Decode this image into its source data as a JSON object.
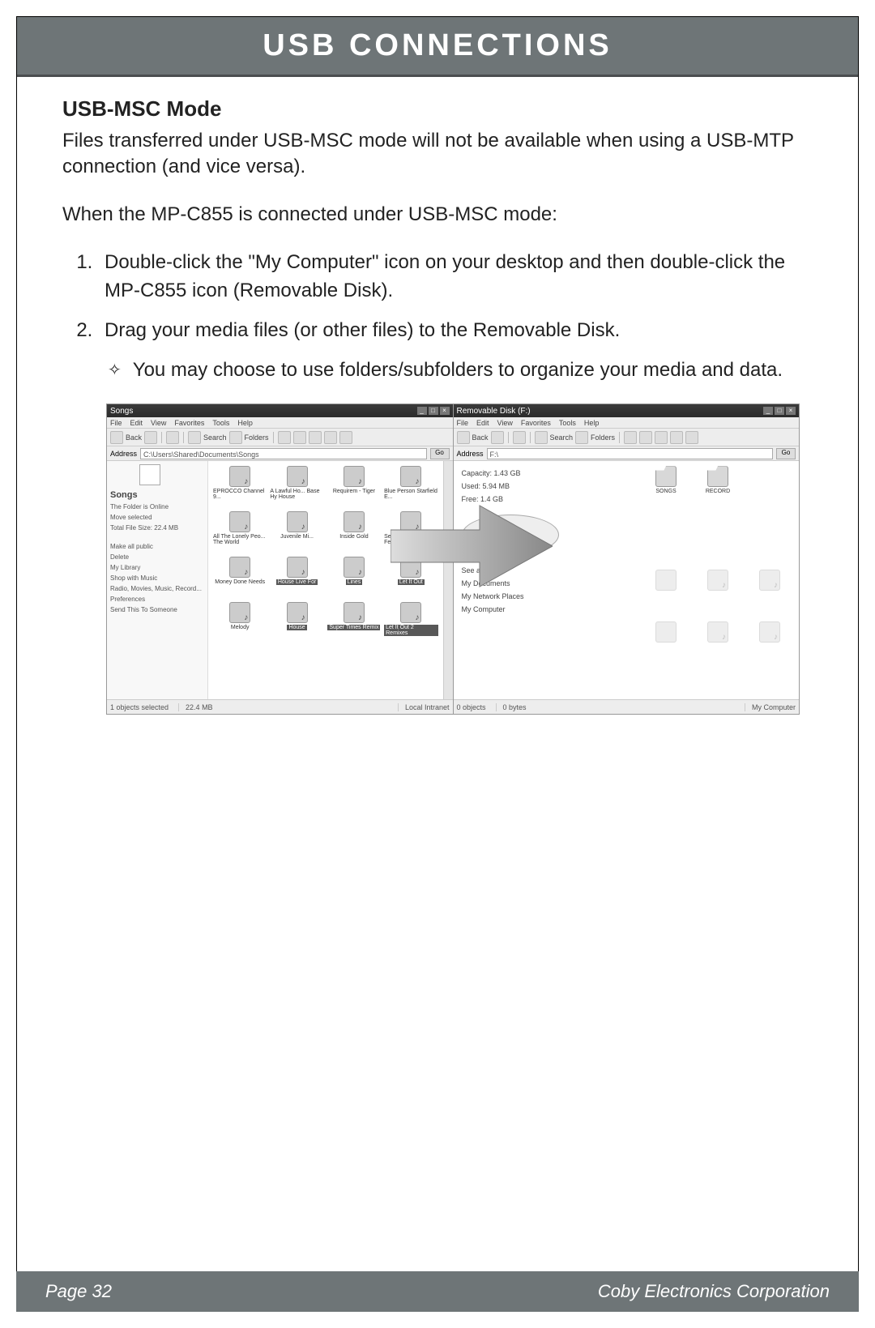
{
  "header": {
    "title": "USB CONNECTIONS"
  },
  "section": {
    "heading": "USB-MSC Mode",
    "intro": "Files transferred under USB-MSC mode will not be available when using a USB-MTP connection (and vice versa).",
    "lead": "When the MP-C855 is connected under USB-MSC mode:",
    "steps": [
      "Double-click the \"My Computer\" icon on your desktop and then double-click the MP-C855 icon (Removable Disk).",
      "Drag your media files (or other files) to the Removable Disk."
    ],
    "subnote": "You may choose to use folders/subfolders to organize your media and data."
  },
  "figure": {
    "left_window": {
      "title": "Songs",
      "menu": [
        "File",
        "Edit",
        "View",
        "Favorites",
        "Tools",
        "Help"
      ],
      "toolbar_labels": {
        "back": "Back",
        "search": "Search",
        "folders": "Folders"
      },
      "address_label": "Address",
      "address_path": "C:\\Users\\Shared\\Documents\\Songs",
      "go": "Go",
      "side": {
        "title": "Songs",
        "items": [
          "The Folder is Online",
          "Move selected",
          "Total File Size: 22.4 MB",
          "Make all public",
          "Delete",
          "My Library",
          "Shop with Music",
          "Radio, Movies, Music, Record...",
          "Preferences",
          "Send This To Someone"
        ]
      },
      "files": [
        "EPROCCO Channel 9...",
        "A Lawful Ho... Base Hy House",
        "Requirem - Tiger",
        "Blue Person Starfield E...",
        "All The Lonely Peo... The World",
        "Juvenile Mi...",
        "Inside Gold",
        "Seas of Blue... Feeds",
        "Money Done Needs",
        "House Live For",
        "Lines",
        "Let It Out",
        "Melody",
        "House",
        "Super Times Remix",
        "Let It Out 2 Remixes"
      ],
      "status": {
        "left": "1 objects selected",
        "mid": "22.4 MB",
        "right": "Local Intranet"
      }
    },
    "right_window": {
      "title": "Removable Disk (F:)",
      "menu": [
        "File",
        "Edit",
        "View",
        "Favorites",
        "Tools",
        "Help"
      ],
      "toolbar_labels": {
        "back": "Back",
        "search": "Search",
        "folders": "Folders"
      },
      "address_label": "Address",
      "address_path": "F:\\",
      "go": "Go",
      "drive": {
        "capacity": "Capacity: 1.43 GB",
        "used": "Used: 5.94 MB",
        "free": "Free: 1.4 GB",
        "links": [
          "See also:",
          "My Documents",
          "My Network Places",
          "My Computer"
        ]
      },
      "files": [
        "SONGS",
        "RECORD",
        "",
        "",
        "",
        "",
        "",
        "",
        ""
      ],
      "status": {
        "left": "0 objects",
        "mid": "0 bytes",
        "right": "My Computer"
      }
    }
  },
  "footer": {
    "page": "Page 32",
    "company": "Coby Electronics Corporation"
  }
}
